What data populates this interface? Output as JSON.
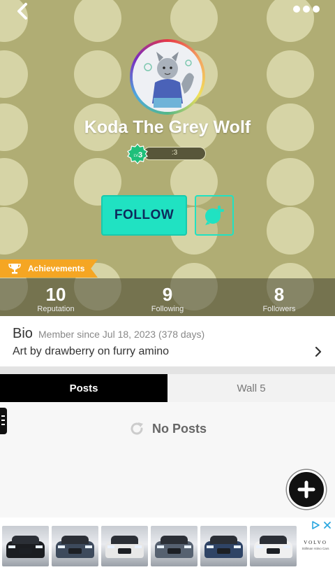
{
  "profile": {
    "name": "Koda The Grey Wolf",
    "level_prefix": "LV",
    "level": "3",
    "level_bar_text": ":3",
    "follow_label": "FOLLOW",
    "achievements_label": "Achievements"
  },
  "stats": [
    {
      "value": "10",
      "label": "Reputation"
    },
    {
      "value": "9",
      "label": "Following"
    },
    {
      "value": "8",
      "label": "Followers"
    }
  ],
  "bio": {
    "title": "Bio",
    "member_since": "Member since Jul 18, 2023 (378 days)",
    "text": "Art by drawberry on furry amino"
  },
  "tabs": {
    "posts": "Posts",
    "wall": "Wall 5"
  },
  "empty_state": {
    "text": "No Posts"
  },
  "ad": {
    "brand": "VOLVO",
    "dealer": "Stillman Volvo Cars"
  },
  "colors": {
    "header_bg": "#b0ad74",
    "accent_teal": "#20e2c2",
    "achievements_orange": "#f5a623"
  },
  "icons": [
    "back-icon",
    "more-icon",
    "level-badge-icon",
    "chat-add-icon",
    "trophy-icon",
    "chevron-right-icon",
    "refresh-icon",
    "plus-icon",
    "menu-icon",
    "adchoices-icon",
    "close-icon"
  ]
}
